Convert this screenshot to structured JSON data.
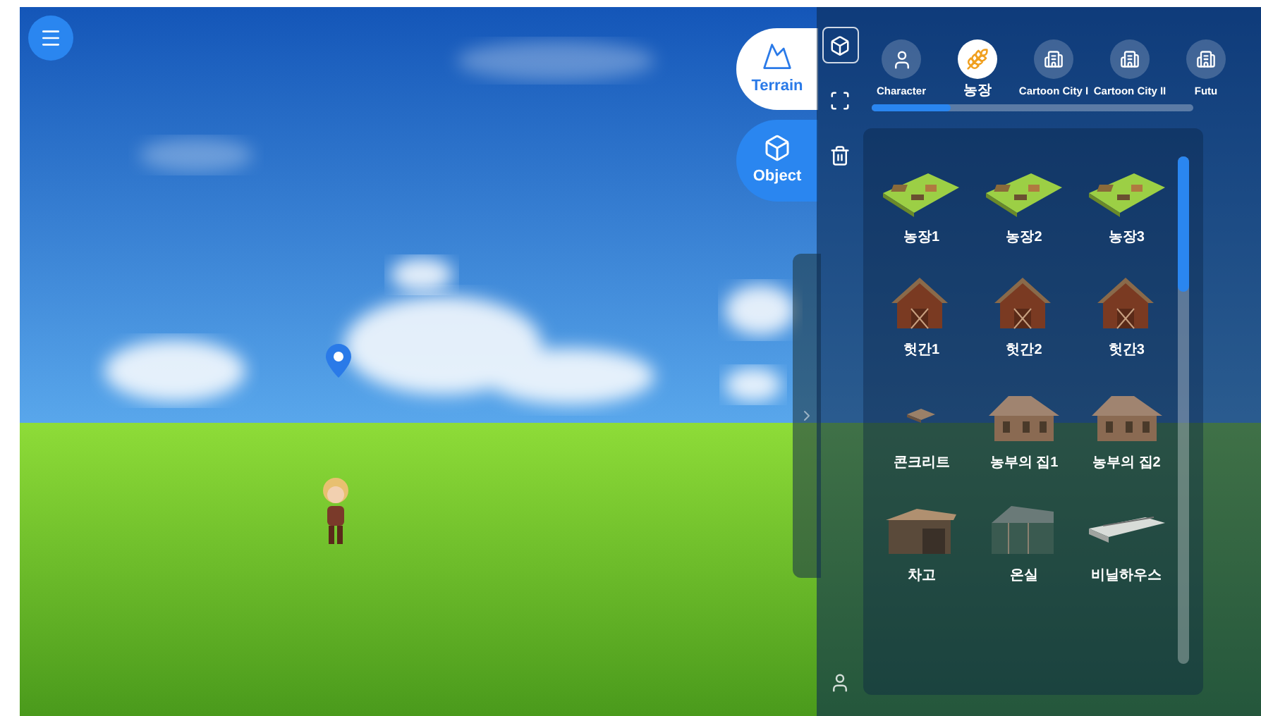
{
  "mode_tabs": [
    {
      "label": "Terrain",
      "kind": "mountain",
      "selected": true
    },
    {
      "label": "Object",
      "kind": "cube",
      "selected": false
    }
  ],
  "toolbar": [
    {
      "kind": "cube",
      "selected": true
    },
    {
      "kind": "fit",
      "selected": false
    },
    {
      "kind": "trash",
      "selected": false
    }
  ],
  "categories": [
    {
      "label": "Character",
      "kind": "person",
      "selected": false
    },
    {
      "label": "농장",
      "kind": "wheat",
      "selected": true
    },
    {
      "label": "Cartoon City I",
      "kind": "building",
      "selected": false
    },
    {
      "label": "Cartoon City II",
      "kind": "building",
      "selected": false
    },
    {
      "label": "Futu",
      "kind": "building",
      "selected": false
    }
  ],
  "items": [
    {
      "label": "농장1",
      "kind": "farm"
    },
    {
      "label": "농장2",
      "kind": "farm"
    },
    {
      "label": "농장3",
      "kind": "farm"
    },
    {
      "label": "헛간1",
      "kind": "barn"
    },
    {
      "label": "헛간2",
      "kind": "barn"
    },
    {
      "label": "헛간3",
      "kind": "barn"
    },
    {
      "label": "콘크리트",
      "kind": "slab"
    },
    {
      "label": "농부의 집1",
      "kind": "house"
    },
    {
      "label": "농부의 집2",
      "kind": "house"
    },
    {
      "label": "차고",
      "kind": "garage"
    },
    {
      "label": "온실",
      "kind": "greenhouse"
    },
    {
      "label": "비닐하우스",
      "kind": "tunnel"
    }
  ]
}
